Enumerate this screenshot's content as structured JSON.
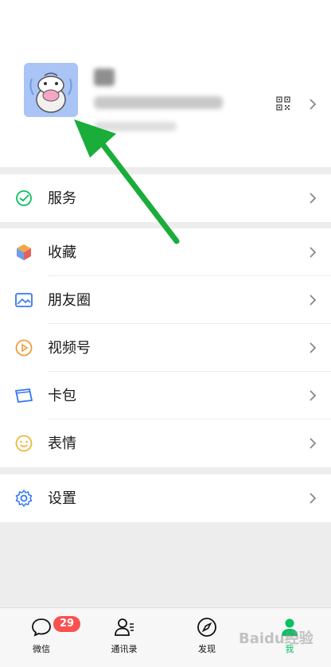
{
  "profile": {
    "name_blurred": "",
    "id_blurred": ""
  },
  "menu": {
    "services": "服务",
    "favorites": "收藏",
    "moments": "朋友圈",
    "channels": "视频号",
    "cards": "卡包",
    "stickers": "表情",
    "settings": "设置"
  },
  "tabs": {
    "chats": "微信",
    "contacts": "通讯录",
    "discover": "发现",
    "me": "我",
    "chats_badge": "29"
  },
  "watermark": "Baidu经验",
  "colors": {
    "accent_green": "#07c160",
    "annotation_green": "#1aad3a",
    "badge_red": "#fa5151"
  }
}
